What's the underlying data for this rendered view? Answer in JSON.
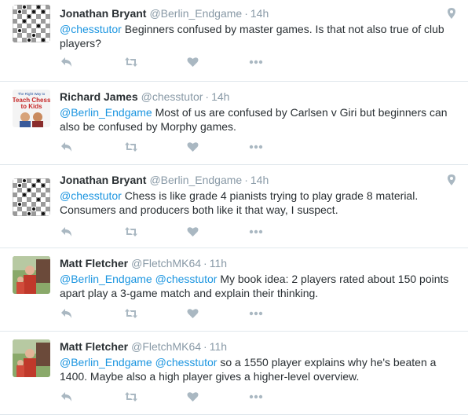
{
  "tweets": [
    {
      "fullname": "Jonathan Bryant",
      "username": "@Berlin_Endgame",
      "dot": "·",
      "time": "14h",
      "avatar": "chessboard-avatar",
      "geo": true,
      "mentions": [
        "@chesstutor"
      ],
      "text": " Beginners confused by master games.  Is that not also true of club players?"
    },
    {
      "fullname": "Richard James",
      "username": "@chesstutor",
      "dot": "·",
      "time": "14h",
      "avatar": "book-cover-avatar",
      "avatar_text": [
        "The Right Way to",
        "Teach Chess",
        "to Kids"
      ],
      "geo": false,
      "mentions": [
        "@Berlin_Endgame"
      ],
      "text": " Most of us are confused by Carlsen v Giri but beginners can also be confused by Morphy games."
    },
    {
      "fullname": "Jonathan Bryant",
      "username": "@Berlin_Endgame",
      "dot": "·",
      "time": "14h",
      "avatar": "chessboard-avatar",
      "geo": true,
      "mentions": [
        "@chesstutor"
      ],
      "text": " Chess is like grade 4 pianists trying to play grade 8 material. Consumers and producers both like it that way, I suspect."
    },
    {
      "fullname": "Matt Fletcher",
      "username": "@FletchMK64",
      "dot": "·",
      "time": "11h",
      "avatar": "photo-avatar",
      "geo": false,
      "mentions": [
        "@Berlin_Endgame",
        "@chesstutor"
      ],
      "text": " My book idea: 2 players rated about 150 points apart play a 3-game match and explain their thinking."
    },
    {
      "fullname": "Matt Fletcher",
      "username": "@FletchMK64",
      "dot": "·",
      "time": "11h",
      "avatar": "photo-avatar",
      "geo": false,
      "mentions": [
        "@Berlin_Endgame",
        "@chesstutor"
      ],
      "text": " so a 1550 player explains why he's beaten a 1400. Maybe also a high player gives a higher-level overview."
    }
  ],
  "actions": [
    "reply-icon",
    "retweet-icon",
    "like-icon",
    "more-icon"
  ],
  "colors": {
    "name": "#292f33",
    "meta": "#8899a6",
    "mention": "#1b95e0",
    "action_icon": "#aab8c2",
    "border": "#e1e8ed"
  }
}
